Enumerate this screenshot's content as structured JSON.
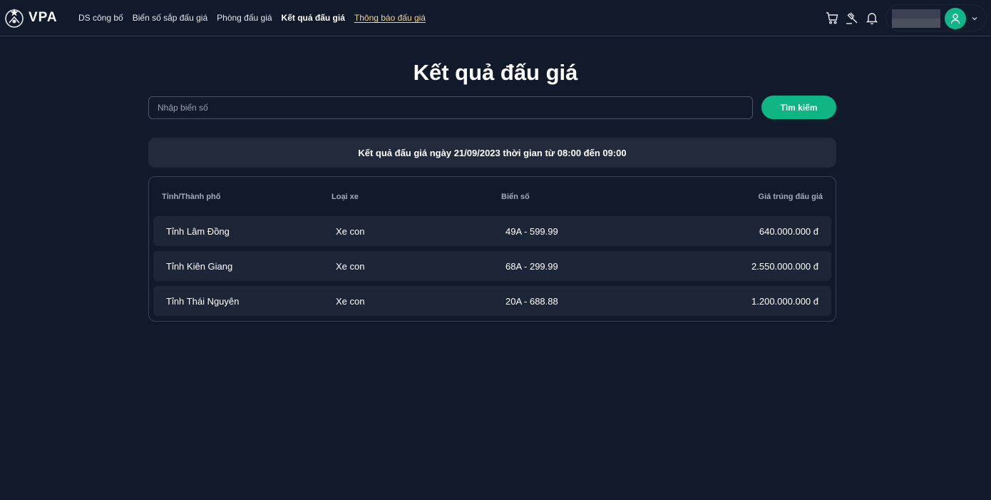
{
  "header": {
    "logo_text": "VPA",
    "nav": [
      {
        "label": "DS công bố"
      },
      {
        "label": "Biển số sắp đấu giá"
      },
      {
        "label": "Phòng đấu giá"
      },
      {
        "label": "Kết quả đấu giá"
      },
      {
        "label": "Thông báo đấu giá"
      }
    ],
    "icons": [
      "cart-icon",
      "gavel-icon",
      "bell-icon"
    ],
    "accent_color": "#10b584"
  },
  "main": {
    "title": "Kết quả đấu giá",
    "search": {
      "placeholder": "Nhập biển số",
      "value": "",
      "button_label": "Tìm kiếm"
    },
    "session_banner": "Kết quả đấu giá ngày 21/09/2023 thời gian từ 08:00 đến 09:00",
    "table": {
      "headers": [
        "Tỉnh/Thành phố",
        "Loại xe",
        "Biển số",
        "Giá trúng đấu giá"
      ],
      "rows": [
        [
          "Tỉnh Lâm Đồng",
          "Xe con",
          "49A - 599.99",
          "640.000.000 đ"
        ],
        [
          "Tỉnh Kiên Giang",
          "Xe con",
          "68A - 299.99",
          "2.550.000.000 đ"
        ],
        [
          "Tỉnh Thái Nguyên",
          "Xe con",
          "20A - 688.88",
          "1.200.000.000 đ"
        ]
      ]
    }
  }
}
